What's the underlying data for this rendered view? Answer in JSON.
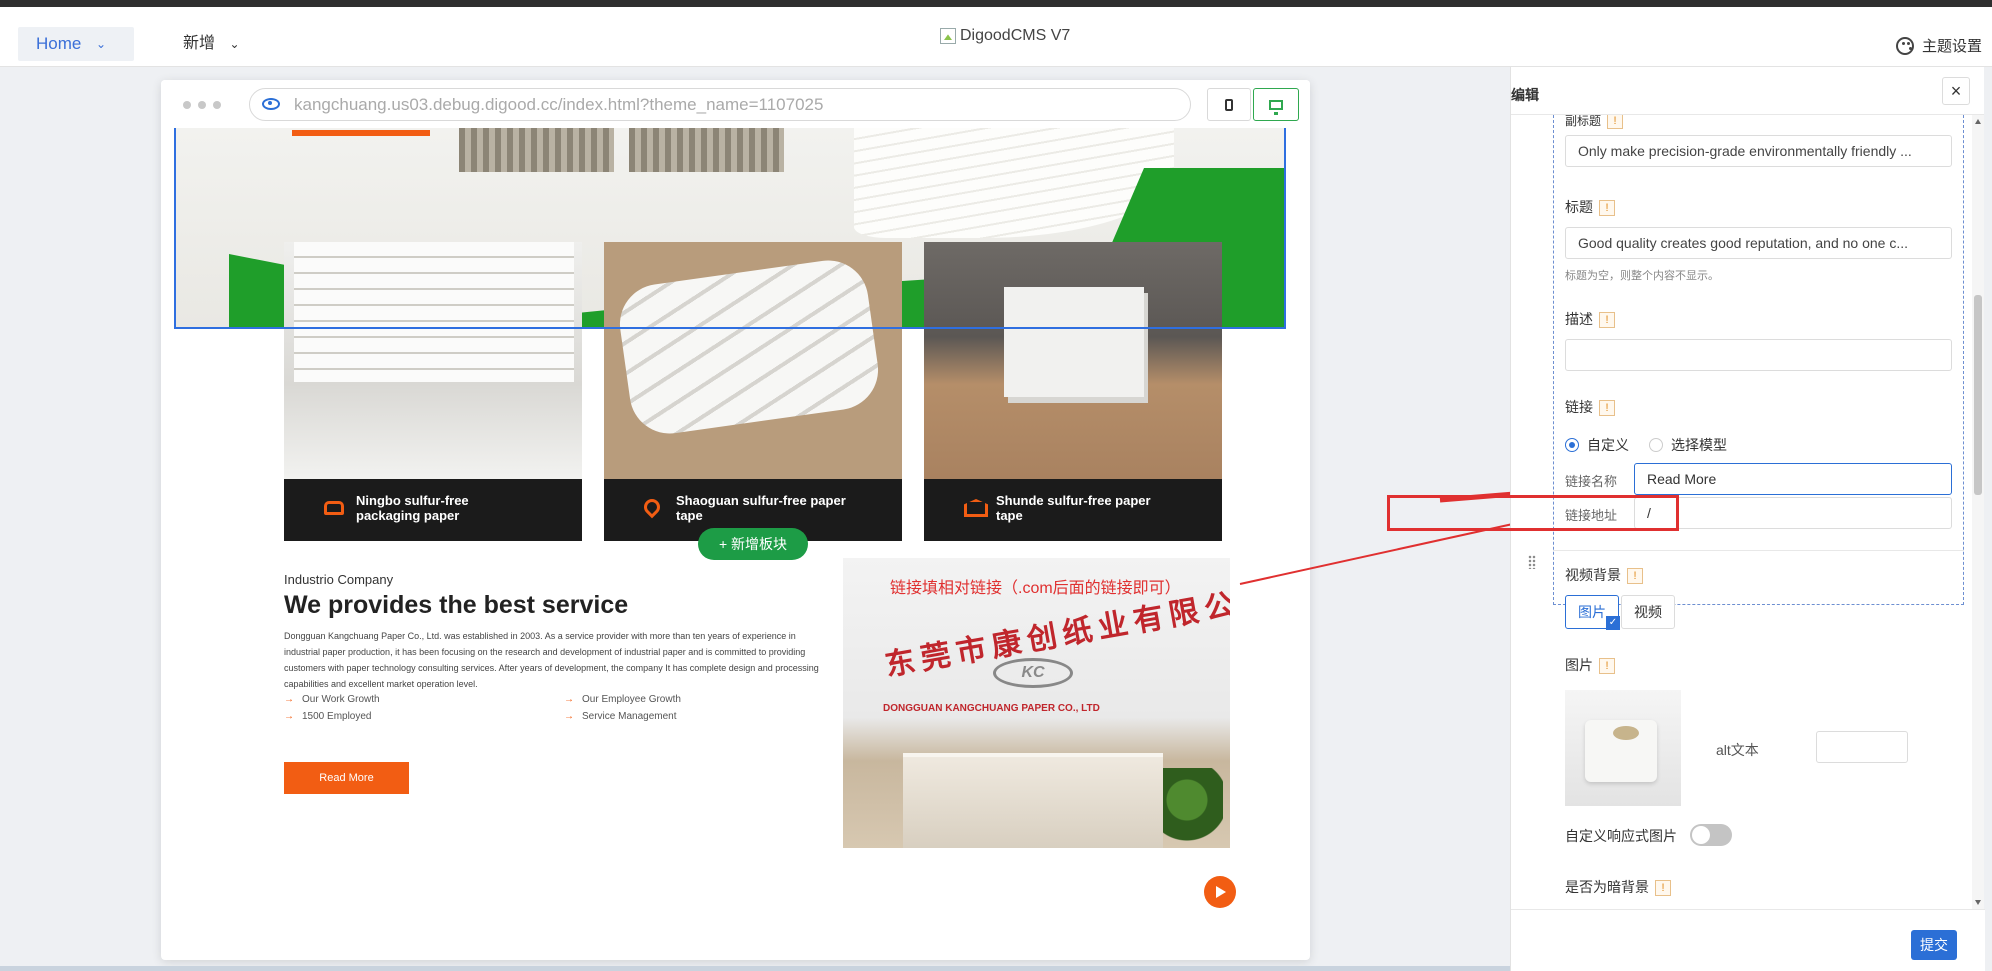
{
  "topbar": {
    "home_label": "Home",
    "add_label": "新增",
    "logo_alt": "DigoodCMS V7",
    "theme_label": "主题设置"
  },
  "browser": {
    "url": "kangchuang.us03.debug.digood.cc/index.html?theme_name=1107025",
    "active_device": "desktop"
  },
  "preview": {
    "cards": [
      {
        "caption_line1": "Ningbo sulfur-free",
        "caption_line2": "packaging paper",
        "icon": "car-icon"
      },
      {
        "caption_line1": "Shaoguan sulfur-free paper",
        "caption_line2": "tape",
        "icon": "location-pin-icon"
      },
      {
        "caption_line1": "Shunde sulfur-free paper",
        "caption_line2": "tape",
        "icon": "building-icon"
      }
    ],
    "add_block_label": "+ 新增板块",
    "about": {
      "subtitle": "Industrio Company",
      "title": "We provides the best service",
      "description": "Dongguan Kangchuang Paper Co., Ltd. was established in 2003. As a service provider with more than ten years of experience in industrial paper production, it has been focusing on the research and development of industrial paper and is committed to providing customers with paper technology consulting services. After years of development, the company It has complete design and processing capabilities and excellent market operation level.",
      "features": [
        "Our Work Growth",
        "Our Employee Growth",
        "1500 Employed",
        "Service Management"
      ],
      "button_label": "Read More"
    },
    "office_image": {
      "banner_text": "东莞市康创纸业有限公司",
      "logo_text": "KC",
      "english_name": "DONGGUAN KANGCHUANG PAPER CO.,  LTD"
    }
  },
  "annotation": {
    "text": "链接填相对链接（.com后面的链接即可）",
    "color": "#e03030"
  },
  "panel": {
    "title": "编辑",
    "close_label": "×",
    "subtitle_label": "副标题",
    "subtitle_value": "Only make precision-grade environmentally friendly ...",
    "title_label": "标题",
    "title_value": "Good quality creates good reputation, and no one c...",
    "title_hint": "标题为空，则整个内容不显示。",
    "desc_label": "描述",
    "desc_value": "",
    "link_label": "链接",
    "radio_custom": "自定义",
    "radio_model": "选择模型",
    "link_name_label": "链接名称",
    "link_name_value": "Read More",
    "link_url_label": "链接地址",
    "link_url_value": "/",
    "video_bg_label": "视频背景",
    "btn_image": "图片",
    "btn_video": "视频",
    "image_label": "图片",
    "alt_label": "alt文本",
    "alt_value": "",
    "responsive_label": "自定义响应式图片",
    "dark_bg_label": "是否为暗背景",
    "submit_label": "提交",
    "exclaim": "!"
  },
  "colors": {
    "accent_blue": "#2b6fd6",
    "brand_orange": "#f25d13",
    "brand_green": "#1f9e2a",
    "annotation_red": "#e03030"
  }
}
